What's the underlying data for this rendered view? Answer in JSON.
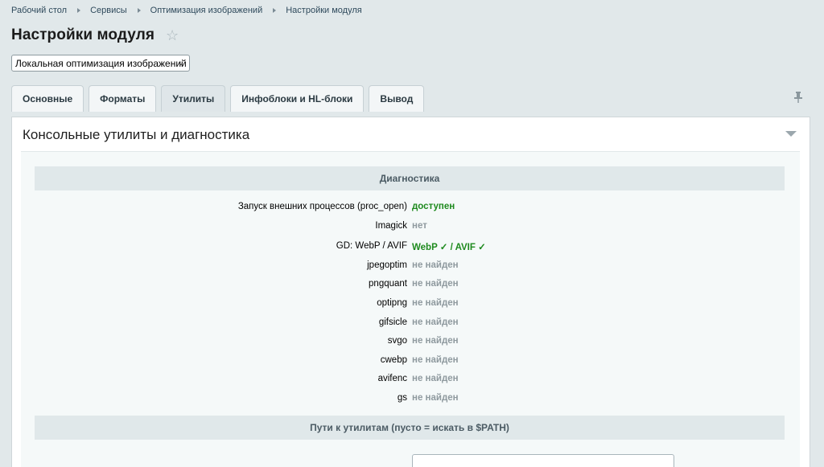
{
  "breadcrumb": [
    "Рабочий стол",
    "Сервисы",
    "Оптимизация изображений",
    "Настройки модуля"
  ],
  "page_title": "Настройки модуля",
  "module_select": {
    "value": "Локальная оптимизация изображений"
  },
  "tabs": [
    {
      "label": "Основные"
    },
    {
      "label": "Форматы"
    },
    {
      "label": "Утилиты"
    },
    {
      "label": "Инфоблоки и HL-блоки"
    },
    {
      "label": "Вывод"
    }
  ],
  "active_tab": "Утилиты",
  "panel": {
    "title": "Консольные утилиты и диагностика",
    "diagnostics_title": "Диагностика",
    "rows": [
      {
        "label": "Запуск внешних процессов (proc_open)",
        "value": "доступен",
        "status": "ok"
      },
      {
        "label": "Imagick",
        "value": "нет",
        "status": "none"
      },
      {
        "label": "GD: WebP / AVIF",
        "value_webp": "WebP ✓",
        "value_sep": "/",
        "value_avif": "AVIF ✓",
        "status": "ok"
      },
      {
        "label": "jpegoptim",
        "value": "не найден",
        "status": "none"
      },
      {
        "label": "pngquant",
        "value": "не найден",
        "status": "none"
      },
      {
        "label": "optipng",
        "value": "не найден",
        "status": "none"
      },
      {
        "label": "gifsicle",
        "value": "не найден",
        "status": "none"
      },
      {
        "label": "svgo",
        "value": "не найден",
        "status": "none"
      },
      {
        "label": "cwebp",
        "value": "не найден",
        "status": "none"
      },
      {
        "label": "avifenc",
        "value": "не найден",
        "status": "none"
      },
      {
        "label": "gs",
        "value": "не найден",
        "status": "none"
      }
    ],
    "paths_title": "Пути к утилитам (пусто = искать в $PATH)"
  },
  "colors": {
    "ok": "#1e8a1e",
    "none": "#8f9a9f",
    "background": "#e1e8ea"
  },
  "icons": {
    "star": "star-icon",
    "pin": "pin-icon",
    "collapse": "collapse-icon",
    "chevron": "chevron-down-icon"
  }
}
